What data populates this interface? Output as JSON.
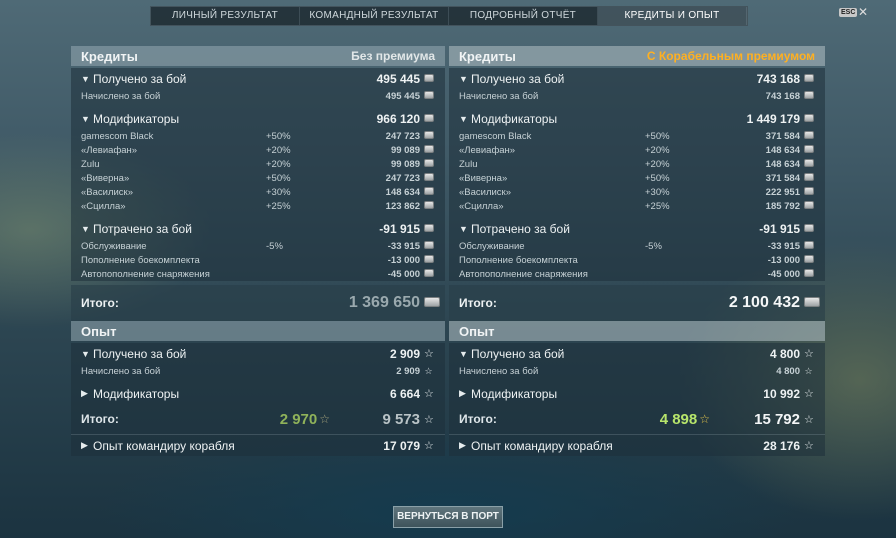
{
  "tabs": [
    "ЛИЧНЫЙ РЕЗУЛЬТАТ",
    "КОМАНДНЫЙ РЕЗУЛЬТАТ",
    "ПОДРОБНЫЙ ОТЧЁТ",
    "КРЕДИТЫ И ОПЫТ"
  ],
  "esc": "ESC",
  "close": "✕",
  "left": {
    "credits_title": "Кредиты",
    "credits_note": "Без премиума",
    "earned_label": "Получено за бой",
    "earned_value": "495 445",
    "accrued_label": "Начислено за бой",
    "accrued_value": "495 445",
    "mods_label": "Модификаторы",
    "mods_value": "966 120",
    "mods": [
      {
        "name": "gamescom Black",
        "pct": "+50%",
        "value": "247 723"
      },
      {
        "name": "«Левиафан»",
        "pct": "+20%",
        "value": "99 089"
      },
      {
        "name": "Zulu",
        "pct": "+20%",
        "value": "99 089"
      },
      {
        "name": "«Виверна»",
        "pct": "+50%",
        "value": "247 723"
      },
      {
        "name": "«Василиск»",
        "pct": "+30%",
        "value": "148 634"
      },
      {
        "name": "«Сцилла»",
        "pct": "+25%",
        "value": "123 862"
      }
    ],
    "spent_label": "Потрачено за бой",
    "spent_value": "-91 915",
    "spent": [
      {
        "name": "Обслуживание",
        "pct": "-5%",
        "value": "-33 915"
      },
      {
        "name": "Пополнение боекомплекта",
        "pct": "",
        "value": "-13 000"
      },
      {
        "name": "Автопополнение снаряжения",
        "pct": "",
        "value": "-45 000"
      }
    ],
    "total_label": "Итого:",
    "total_value": "1 369 650",
    "xp_title": "Опыт",
    "xp_earned_label": "Получено за бой",
    "xp_earned_value": "2 909",
    "xp_accrued_label": "Начислено за бой",
    "xp_accrued_value": "2 909",
    "xp_mods_label": "Модификаторы",
    "xp_mods_value": "6 664",
    "xp_total_label": "Итого:",
    "xp_total_free": "2 970",
    "xp_total_value": "9 573",
    "cmdr_label": "Опыт командиру корабля",
    "cmdr_value": "17 079"
  },
  "right": {
    "credits_title": "Кредиты",
    "credits_note": "С Корабельным премиумом",
    "earned_label": "Получено за бой",
    "earned_value": "743 168",
    "accrued_label": "Начислено за бой",
    "accrued_value": "743 168",
    "mods_label": "Модификаторы",
    "mods_value": "1 449 179",
    "mods": [
      {
        "name": "gamescom Black",
        "pct": "+50%",
        "value": "371 584"
      },
      {
        "name": "«Левиафан»",
        "pct": "+20%",
        "value": "148 634"
      },
      {
        "name": "Zulu",
        "pct": "+20%",
        "value": "148 634"
      },
      {
        "name": "«Виверна»",
        "pct": "+50%",
        "value": "371 584"
      },
      {
        "name": "«Василиск»",
        "pct": "+30%",
        "value": "222 951"
      },
      {
        "name": "«Сцилла»",
        "pct": "+25%",
        "value": "185 792"
      }
    ],
    "spent_label": "Потрачено за бой",
    "spent_value": "-91 915",
    "spent": [
      {
        "name": "Обслуживание",
        "pct": "-5%",
        "value": "-33 915"
      },
      {
        "name": "Пополнение боекомплекта",
        "pct": "",
        "value": "-13 000"
      },
      {
        "name": "Автопополнение снаряжения",
        "pct": "",
        "value": "-45 000"
      }
    ],
    "total_label": "Итого:",
    "total_value": "2 100 432",
    "xp_title": "Опыт",
    "xp_earned_label": "Получено за бой",
    "xp_earned_value": "4 800",
    "xp_accrued_label": "Начислено за бой",
    "xp_accrued_value": "4 800",
    "xp_mods_label": "Модификаторы",
    "xp_mods_value": "10 992",
    "xp_total_label": "Итого:",
    "xp_total_free": "4 898",
    "xp_total_value": "15 792",
    "cmdr_label": "Опыт командиру корабля",
    "cmdr_value": "28 176"
  },
  "back_button": "ВЕРНУТЬСЯ В ПОРТ",
  "icons": {
    "credits": "credits-coin-icon",
    "xp": "star-icon",
    "expand": "triangle-icon"
  },
  "colors": {
    "premium_note": "#ffb020",
    "free_xp": "#b7e56b"
  }
}
